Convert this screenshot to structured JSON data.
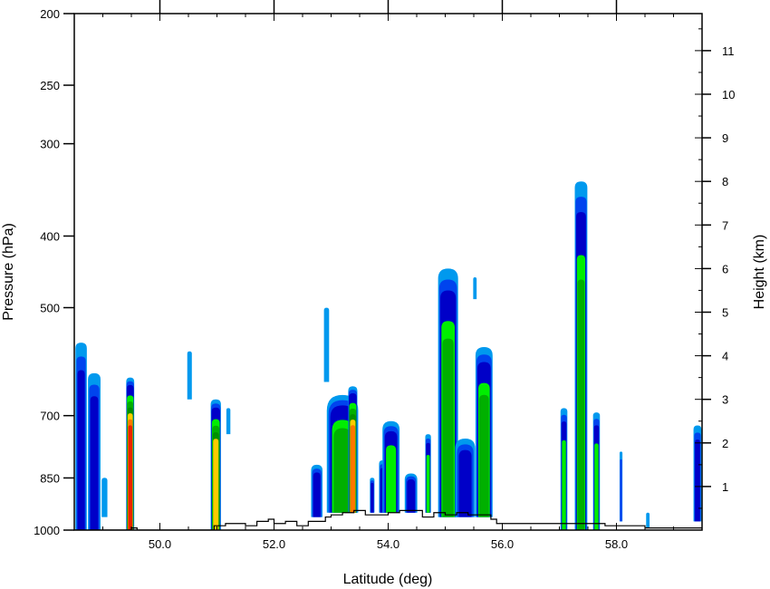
{
  "chart_data": {
    "type": "heatmap",
    "xlabel": "Latitude (deg)",
    "ylabel": "Pressure (hPa)",
    "y2label": "Height (km)",
    "xlim": [
      48.5,
      59.5
    ],
    "ylim_hpa": [
      1000,
      200
    ],
    "y_scale": "log",
    "y2lim_km": [
      0.0,
      11.85
    ],
    "x_ticks": [
      "50.0",
      "52.0",
      "54.0",
      "56.0",
      "58.0"
    ],
    "y_ticks": [
      "200",
      "250",
      "300",
      "400",
      "500",
      "700",
      "850",
      "1000"
    ],
    "y2_ticks": [
      "1",
      "2",
      "3",
      "4",
      "5",
      "6",
      "7",
      "8",
      "9",
      "10",
      "11"
    ],
    "grid": false,
    "legend": "none",
    "colors": [
      "#0099ee",
      "#0044ee",
      "#0000c8",
      "#00ee00",
      "#00b000",
      "#009000",
      "#ffcc00",
      "#ff7700",
      "#ee2200"
    ],
    "cells": [
      {
        "lat": 48.62,
        "width": 0.2,
        "top_km": 4.3,
        "base_km": 0,
        "level": 3
      },
      {
        "lat": 48.85,
        "width": 0.22,
        "top_km": 3.6,
        "base_km": 0,
        "level": 3
      },
      {
        "lat": 49.03,
        "width": 0.1,
        "top_km": 1.2,
        "base_km": 0.3,
        "level": 1
      },
      {
        "lat": 49.48,
        "width": 0.14,
        "top_km": 3.5,
        "base_km": 0,
        "level": 9
      },
      {
        "lat": 50.52,
        "width": 0.08,
        "top_km": 4.1,
        "base_km": 3.0,
        "level": 1
      },
      {
        "lat": 50.98,
        "width": 0.18,
        "top_km": 3.0,
        "base_km": 0,
        "level": 7
      },
      {
        "lat": 51.2,
        "width": 0.07,
        "top_km": 2.8,
        "base_km": 2.2,
        "level": 1
      },
      {
        "lat": 52.75,
        "width": 0.2,
        "top_km": 1.5,
        "base_km": 0.3,
        "level": 3
      },
      {
        "lat": 52.92,
        "width": 0.09,
        "top_km": 5.1,
        "base_km": 3.4,
        "level": 1
      },
      {
        "lat": 53.2,
        "width": 0.55,
        "top_km": 3.1,
        "base_km": 0.4,
        "level": 5
      },
      {
        "lat": 53.38,
        "width": 0.16,
        "top_km": 3.3,
        "base_km": 0.4,
        "level": 8
      },
      {
        "lat": 53.72,
        "width": 0.08,
        "top_km": 1.2,
        "base_km": 0.4,
        "level": 3
      },
      {
        "lat": 53.9,
        "width": 0.12,
        "top_km": 1.6,
        "base_km": 0.4,
        "level": 3
      },
      {
        "lat": 54.05,
        "width": 0.3,
        "top_km": 2.5,
        "base_km": 0.4,
        "level": 4
      },
      {
        "lat": 54.4,
        "width": 0.22,
        "top_km": 1.3,
        "base_km": 0.4,
        "level": 3
      },
      {
        "lat": 54.7,
        "width": 0.1,
        "top_km": 2.2,
        "base_km": 0.4,
        "level": 4
      },
      {
        "lat": 55.05,
        "width": 0.35,
        "top_km": 6.0,
        "base_km": 0.3,
        "level": 5
      },
      {
        "lat": 55.35,
        "width": 0.35,
        "top_km": 2.1,
        "base_km": 0.3,
        "level": 3
      },
      {
        "lat": 55.52,
        "width": 0.06,
        "top_km": 5.8,
        "base_km": 5.3,
        "level": 1
      },
      {
        "lat": 55.68,
        "width": 0.3,
        "top_km": 4.2,
        "base_km": 0.3,
        "level": 5
      },
      {
        "lat": 57.08,
        "width": 0.12,
        "top_km": 2.8,
        "base_km": 0,
        "level": 4
      },
      {
        "lat": 57.38,
        "width": 0.22,
        "top_km": 8.0,
        "base_km": 0,
        "level": 5
      },
      {
        "lat": 57.65,
        "width": 0.12,
        "top_km": 2.7,
        "base_km": 0,
        "level": 4
      },
      {
        "lat": 58.08,
        "width": 0.05,
        "top_km": 1.8,
        "base_km": 0.2,
        "level": 2
      },
      {
        "lat": 58.55,
        "width": 0.06,
        "top_km": 0.4,
        "base_km": 0.05,
        "level": 1
      },
      {
        "lat": 59.42,
        "width": 0.14,
        "top_km": 2.4,
        "base_km": 0.2,
        "level": 3
      }
    ],
    "terrain": {
      "lat": [
        48.5,
        49.45,
        49.5,
        49.6,
        50.85,
        50.95,
        51.15,
        51.3,
        51.5,
        51.7,
        51.9,
        52.0,
        52.2,
        52.4,
        52.6,
        52.9,
        53.0,
        53.2,
        53.4,
        53.6,
        53.8,
        54.0,
        54.2,
        54.4,
        54.6,
        54.8,
        55.0,
        55.2,
        55.4,
        55.6,
        55.8,
        55.9,
        56.5,
        57.0,
        57.8,
        58.0,
        58.5,
        59.0,
        59.5
      ],
      "height_km": [
        0,
        0,
        0.05,
        0,
        0,
        0.1,
        0.15,
        0.15,
        0.1,
        0.2,
        0.25,
        0.15,
        0.2,
        0.1,
        0.2,
        0.3,
        0.35,
        0.4,
        0.45,
        0.35,
        0.35,
        0.4,
        0.45,
        0.45,
        0.3,
        0.4,
        0.35,
        0.4,
        0.35,
        0.35,
        0.25,
        0.15,
        0.15,
        0.15,
        0.1,
        0.1,
        0.05,
        0.05,
        0.05
      ]
    }
  }
}
